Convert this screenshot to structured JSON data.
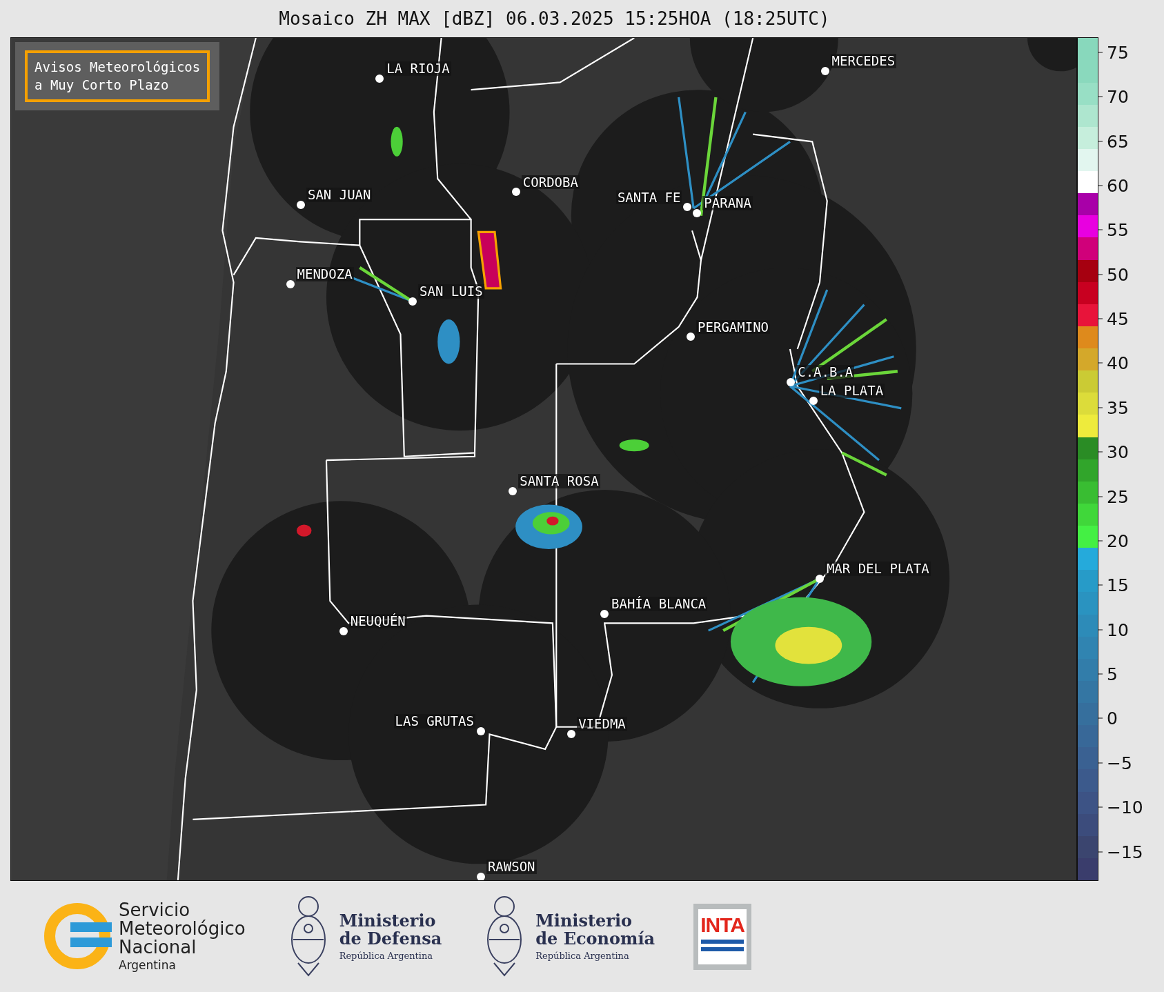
{
  "title": "Mosaico ZH MAX [dBZ] 06.03.2025 15:25HOA (18:25UTC)",
  "warning_box": {
    "lines": [
      "Avisos Meteorológicos",
      "a Muy Corto Plazo"
    ]
  },
  "cities": [
    {
      "name": "LA RIOJA"
    },
    {
      "name": "MERCEDES"
    },
    {
      "name": "CORDOBA"
    },
    {
      "name": "SAN JUAN"
    },
    {
      "name": "SANTA FE"
    },
    {
      "name": "PARANA"
    },
    {
      "name": "MENDOZA"
    },
    {
      "name": "SAN LUIS"
    },
    {
      "name": "PERGAMINO"
    },
    {
      "name": "C.A.B.A"
    },
    {
      "name": "LA PLATA"
    },
    {
      "name": "SANTA ROSA"
    },
    {
      "name": "MAR DEL PLATA"
    },
    {
      "name": "BAHÍA BLANCA"
    },
    {
      "name": "NEUQUÉN"
    },
    {
      "name": "LAS GRUTAS"
    },
    {
      "name": "VIEDMA"
    },
    {
      "name": "RAWSON"
    }
  ],
  "colorbar": {
    "ticks": [
      "75",
      "70",
      "65",
      "60",
      "55",
      "50",
      "45",
      "40",
      "35",
      "30",
      "25",
      "20",
      "15",
      "10",
      "5",
      "0",
      "−5",
      "−10",
      "−15"
    ],
    "segments": [
      {
        "color": "#3a3d6c"
      },
      {
        "color": "#3b456f"
      },
      {
        "color": "#3c4c7c"
      },
      {
        "color": "#3d5385"
      },
      {
        "color": "#3c5a8c"
      },
      {
        "color": "#3a6192"
      },
      {
        "color": "#386898"
      },
      {
        "color": "#366f9d"
      },
      {
        "color": "#3476a3"
      },
      {
        "color": "#327daa"
      },
      {
        "color": "#3084b1"
      },
      {
        "color": "#2d8bb8"
      },
      {
        "color": "#2a93c0"
      },
      {
        "color": "#279bc8"
      },
      {
        "color": "#25aadb"
      },
      {
        "color": "#44f044"
      },
      {
        "color": "#40d73a"
      },
      {
        "color": "#39bd32"
      },
      {
        "color": "#31a52b"
      },
      {
        "color": "#2a8c25"
      },
      {
        "color": "#eeeb3c"
      },
      {
        "color": "#dcdc3a"
      },
      {
        "color": "#cbcb34"
      },
      {
        "color": "#d4a82a"
      },
      {
        "color": "#de8a1c"
      },
      {
        "color": "#e8143a"
      },
      {
        "color": "#c80020"
      },
      {
        "color": "#a60010"
      },
      {
        "color": "#d0007a"
      },
      {
        "color": "#e800e0"
      },
      {
        "color": "#a800a8"
      },
      {
        "color": "#ffffff"
      },
      {
        "color": "#e2f6ef"
      },
      {
        "color": "#c6eedc"
      },
      {
        "color": "#aee6cf"
      },
      {
        "color": "#98dfc5"
      },
      {
        "color": "#8ad9bd"
      },
      {
        "color": "#88d8bc"
      }
    ]
  },
  "footer": {
    "smn": {
      "lines": [
        "Servicio",
        "Meteorológico",
        "Nacional"
      ],
      "country": "Argentina"
    },
    "defensa": {
      "lines": [
        "Ministerio",
        "de Defensa"
      ],
      "country": "República Argentina"
    },
    "economia": {
      "lines": [
        "Ministerio",
        "de Economía"
      ],
      "country": "República Argentina"
    },
    "inta": {
      "text": "INTA"
    }
  }
}
